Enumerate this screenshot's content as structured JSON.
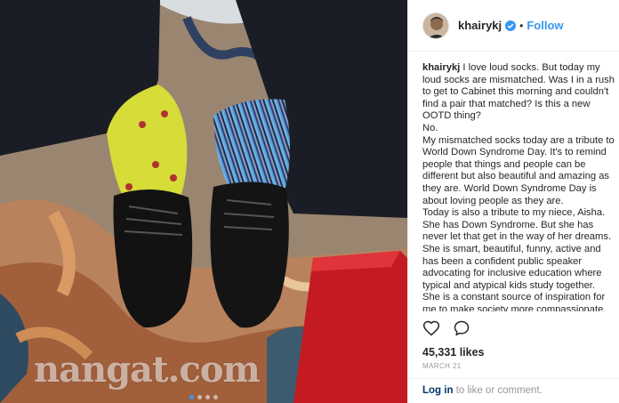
{
  "watermark": "nangat.com",
  "carousel": {
    "count": 4,
    "active": 0
  },
  "post": {
    "username": "khairykj",
    "follow_label": "Follow",
    "separator": "•",
    "caption_user": "khairykj",
    "caption_lines": [
      "I love loud socks. But today my loud socks are mismatched. Was I in a rush to get to Cabinet this morning and couldn't find a pair that matched? Is this a new OOTD thing?",
      "No.",
      "My mismatched socks today are a tribute to World Down Syndrome Day. It's to remind people that things and people can be different but also beautiful and amazing as they are. World Down Syndrome Day is about loving people as they are.",
      "Today is also a tribute to my niece, Aisha. She has Down Syndrome. But she has never let that get in the way of her dreams. She is smart, beautiful, funny, active and has been a confident public speaker advocating for inclusive education where typical and atypical kids study together. She is a constant source of inspiration for me to make society more compassionate, to"
    ],
    "likes": "45,331 likes",
    "date": "MARCH 21",
    "footer": {
      "login": "Log in",
      "rest": " to like or comment."
    }
  },
  "icons": {
    "verified": "verified-badge-icon",
    "like": "heart-icon",
    "comment": "comment-bubble-icon"
  },
  "colors": {
    "accent": "#3897f0",
    "verified": "#3897f0",
    "login_link": "#003569"
  }
}
